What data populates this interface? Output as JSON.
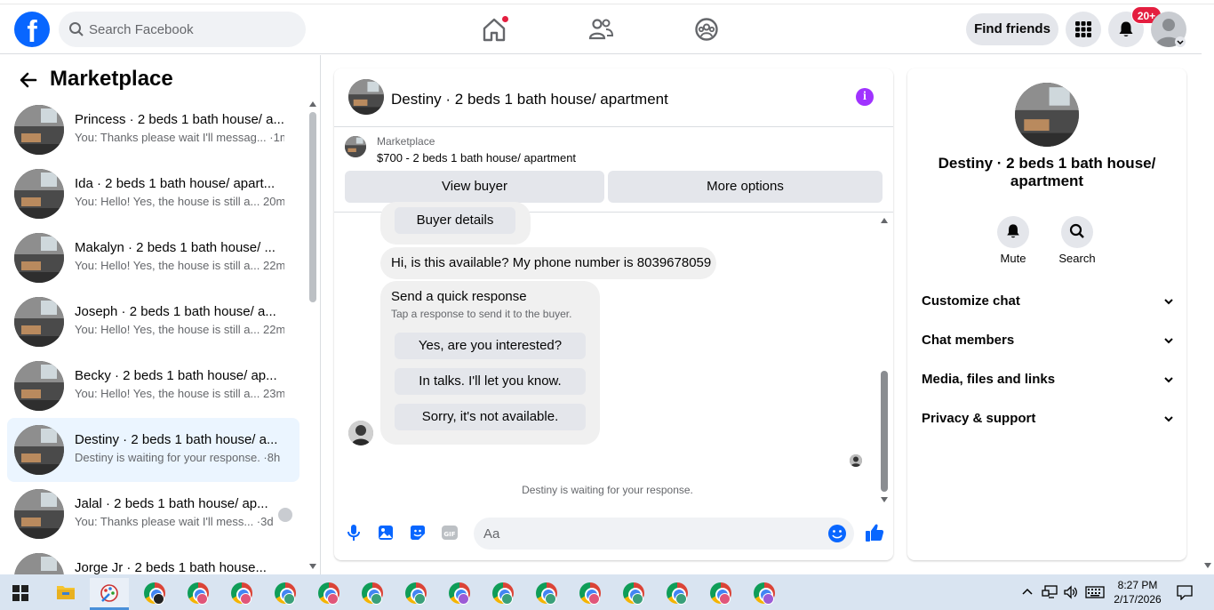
{
  "header": {
    "search_placeholder": "Search Facebook",
    "find_friends": "Find friends",
    "notifications_badge": "20+"
  },
  "sidebar": {
    "title": "Marketplace",
    "conversations": [
      {
        "title": "Princess · 2 beds 1 bath house/ a...",
        "preview": "You: Thanks please wait I'll messag... ·1m"
      },
      {
        "title": "Ida · 2 beds 1 bath house/ apart...",
        "preview": "You: Hello! Yes, the house is still a... 20m"
      },
      {
        "title": "Makalyn · 2 beds 1 bath house/ ...",
        "preview": "You: Hello! Yes, the house is still a... 22m"
      },
      {
        "title": "Joseph · 2 beds 1 bath house/ a...",
        "preview": "You: Hello! Yes, the house is still a... 22m"
      },
      {
        "title": "Becky · 2 beds 1 bath house/ ap...",
        "preview": "You: Hello! Yes, the house is still a... 23m"
      },
      {
        "title": "Destiny · 2 beds 1 bath house/ a...",
        "preview": "Destiny is waiting for your response. ·8h"
      },
      {
        "title": "Jalal · 2 beds 1 bath house/ ap...",
        "preview": "You: Thanks please wait I'll mess... ·3d"
      },
      {
        "title": "Jorge Jr · 2 beds 1 bath house...",
        "preview": ""
      }
    ]
  },
  "chat": {
    "title": "Destiny · 2 beds 1 bath house/ apartment",
    "listing_label": "Marketplace",
    "listing_price": "$700 - 2 beds 1 bath house/ apartment",
    "view_buyer": "View buyer",
    "more_options": "More options",
    "buyer_details": "Buyer details",
    "message": "Hi, is this available? My phone number is 8039678059",
    "quick_title": "Send a quick response",
    "quick_subtitle": "Tap a response to send it to the buyer.",
    "quick_responses": [
      "Yes, are you interested?",
      "In talks. I'll let you know.",
      "Sorry, it's not available."
    ],
    "waiting": "Destiny is waiting for your response.",
    "composer_placeholder": "Aa"
  },
  "panel": {
    "title": "Destiny · 2 beds 1 bath house/ apartment",
    "mute": "Mute",
    "search": "Search",
    "sections": [
      "Customize chat",
      "Chat members",
      "Media, files and links",
      "Privacy & support"
    ]
  },
  "taskbar": {
    "time": "8:27 PM",
    "date": "2/17/2026"
  },
  "colors": {
    "facebook_blue": "#0866ff",
    "active_conversation": "#ebf5ff",
    "notification_red": "#e41e3f",
    "info_purple": "#a033ff"
  }
}
